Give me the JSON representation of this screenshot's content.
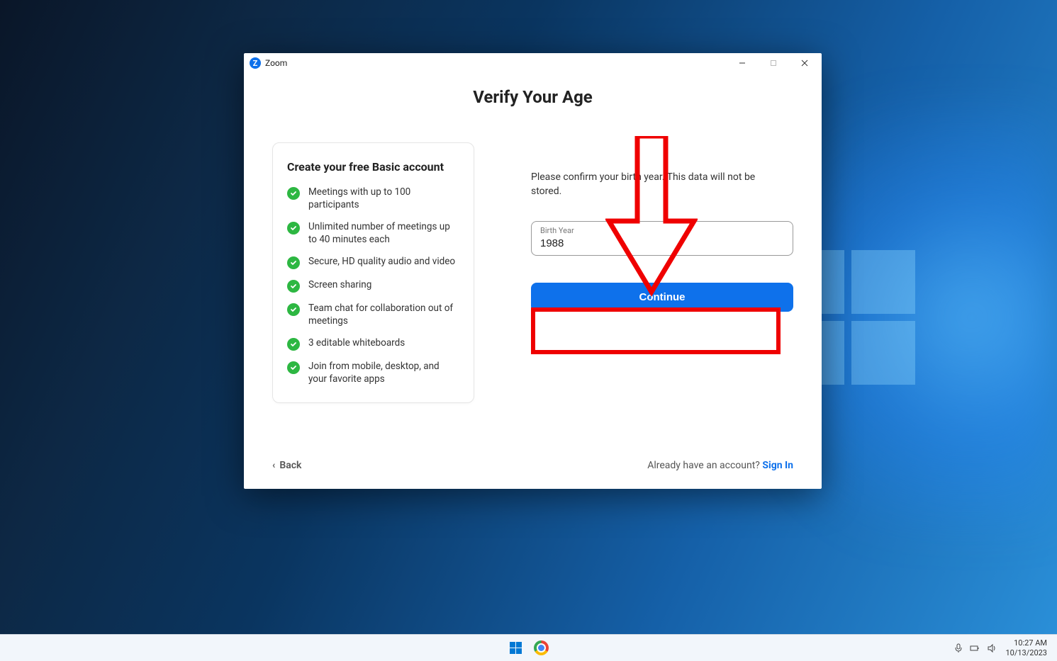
{
  "window": {
    "app_name": "Zoom"
  },
  "page": {
    "title": "Verify Your Age",
    "instruction": "Please confirm your birth year. This data will not be stored."
  },
  "card": {
    "title": "Create your free Basic account",
    "features": [
      "Meetings with up to 100 participants",
      "Unlimited number of meetings up to 40 minutes each",
      "Secure, HD quality audio and video",
      "Screen sharing",
      "Team chat for collaboration out of meetings",
      "3 editable whiteboards",
      "Join from mobile, desktop, and your favorite apps"
    ]
  },
  "form": {
    "birth_label": "Birth Year",
    "birth_value": "1988",
    "continue_label": "Continue"
  },
  "footer": {
    "back_label": "Back",
    "already_text": "Already have an account? ",
    "sign_in": "Sign In"
  },
  "taskbar": {
    "time": "10:27 AM",
    "date": "10/13/2023"
  },
  "annotation": {
    "arrow_color": "#ef0000",
    "box_color": "#ef0000"
  }
}
